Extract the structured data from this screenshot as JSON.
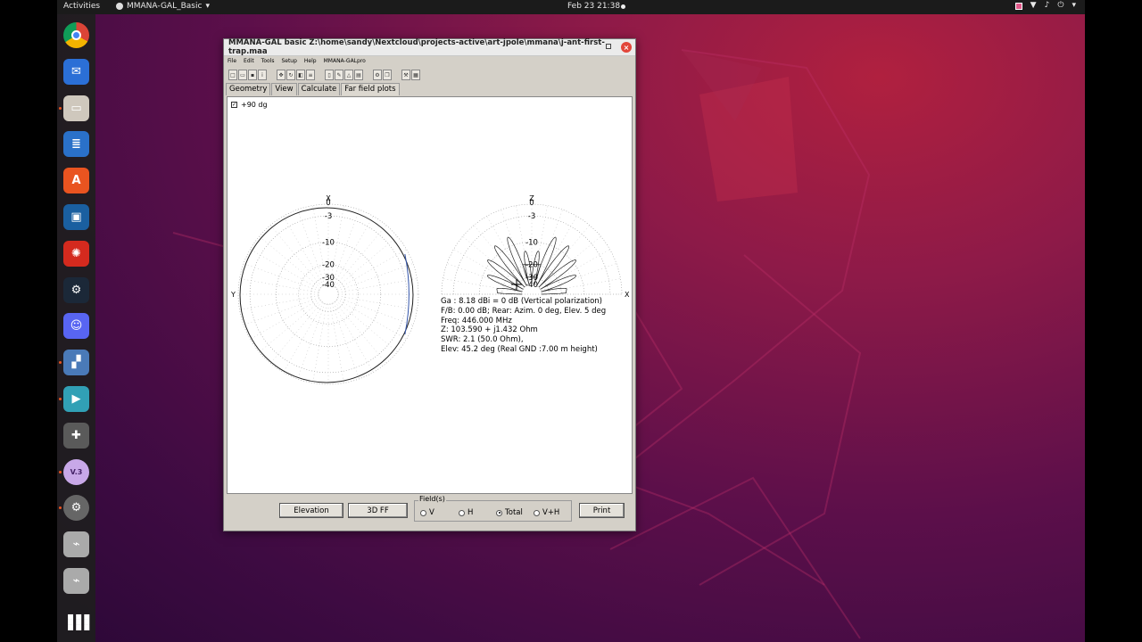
{
  "topbar": {
    "activities": "Activities",
    "app_name": "MMANA-GAL_Basic",
    "app_menu_arrow": "▾",
    "clock": "Feb 23  21:38",
    "tray_icons": [
      "record-icon",
      "wifi-icon",
      "volume-icon",
      "power-icon"
    ],
    "tray_arrow": "▾"
  },
  "dock": {
    "items": [
      {
        "name": "chrome",
        "color": "#e8e8e8",
        "running": false
      },
      {
        "name": "thunderbird",
        "color": "#2b6fd6",
        "running": false
      },
      {
        "name": "files",
        "color": "#cfc8bd",
        "running": true
      },
      {
        "name": "libreoffice-writer",
        "color": "#2a71c9",
        "running": false
      },
      {
        "name": "ubuntu-software",
        "color": "#e95420",
        "running": false
      },
      {
        "name": "virtual-box",
        "color": "#1a5fa0",
        "running": false
      },
      {
        "name": "wolfram",
        "color": "#d42a1e",
        "running": false
      },
      {
        "name": "steam",
        "color": "#1b2838",
        "running": false
      },
      {
        "name": "discord",
        "color": "#5865f2",
        "running": false
      },
      {
        "name": "screenshot-tool",
        "color": "#4a7ab8",
        "running": true
      },
      {
        "name": "video-editor",
        "color": "#31a0b5",
        "running": true
      },
      {
        "name": "extension",
        "color": "#5a5a5a",
        "running": false
      },
      {
        "name": "mmana-gal",
        "color": "#9d7ad6",
        "running": true
      },
      {
        "name": "settings",
        "color": "#666666",
        "running": true
      },
      {
        "name": "usb-drive-1",
        "color": "#aaaaaa",
        "running": false
      },
      {
        "name": "usb-drive-2",
        "color": "#aaaaaa",
        "running": false
      }
    ],
    "show_apps": "⋮⋮⋮"
  },
  "window": {
    "title": "MMANA-GAL basic Z:\\home\\sandy\\Nextcloud\\projects-active\\art-jpole\\mmana\\j-ant-first-trap.maa",
    "menu": [
      "File",
      "Edit",
      "Tools",
      "Setup",
      "Help",
      "MMANA-GALpro"
    ],
    "tabs": [
      "Geometry",
      "View",
      "Calculate",
      "Far field plots"
    ],
    "active_tab": "Far field plots",
    "checkbox_label": "+90 dg",
    "checkbox_mark": "✓",
    "plot_left": {
      "top_label": "X",
      "side_label": "Y",
      "ring_labels": [
        "0",
        "-3",
        "-10",
        "-20",
        "-30",
        "-40"
      ]
    },
    "plot_right": {
      "top_label": "Z",
      "side_label": "X",
      "ring_labels": [
        "0",
        "-3",
        "-10",
        "-20",
        "-30",
        "-40"
      ]
    },
    "info_lines": [
      "Ga : 8.18 dBi = 0 dB  (Vertical polarization)",
      "F/B: 0.00 dB; Rear: Azim. 0 deg,  Elev. 5 deg",
      "Freq: 446.000 MHz",
      "Z: 103.590 + j1.432 Ohm",
      "SWR: 2.1 (50.0 Ohm),",
      "Elev: 45.2 deg (Real GND  :7.00 m height)"
    ],
    "buttons": {
      "elevation": "Elevation",
      "ff3d": "3D FF",
      "print": "Print"
    },
    "fields": {
      "legend": "Field(s)",
      "options": [
        "V",
        "H",
        "Total",
        "V+H"
      ],
      "selected": "Total"
    }
  }
}
